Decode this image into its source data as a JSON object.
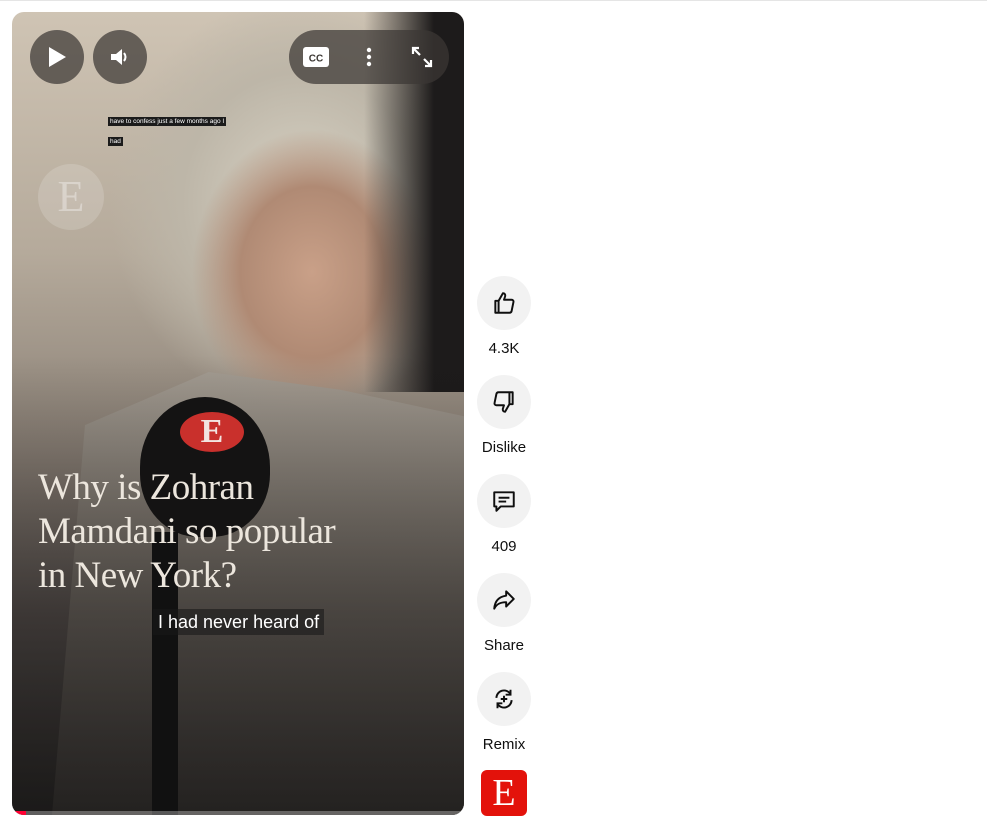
{
  "player": {
    "tiny_caption_line1": "have to confess just a few months ago I",
    "tiny_caption_line2": "had",
    "watermark_letter": "E",
    "mic_logo_letter": "E",
    "headline_line1": "Why is Zohran",
    "headline_line2": "Mamdani so popular",
    "headline_line3": "in New York?",
    "subtitle": "I had never heard of",
    "cc_label": "CC",
    "progress_fraction": 0.03,
    "progress_color": "#ff0033"
  },
  "actions": {
    "like_count": "4.3K",
    "dislike_label": "Dislike",
    "comment_count": "409",
    "share_label": "Share",
    "remix_label": "Remix"
  },
  "channel": {
    "avatar_letter": "E",
    "brand_color": "#e3120b"
  },
  "icons": [
    "play-icon",
    "volume-icon",
    "cc-icon",
    "more-vertical-icon",
    "fullscreen-icon",
    "thumbs-up-icon",
    "thumbs-down-icon",
    "comment-icon",
    "share-icon",
    "remix-icon"
  ]
}
